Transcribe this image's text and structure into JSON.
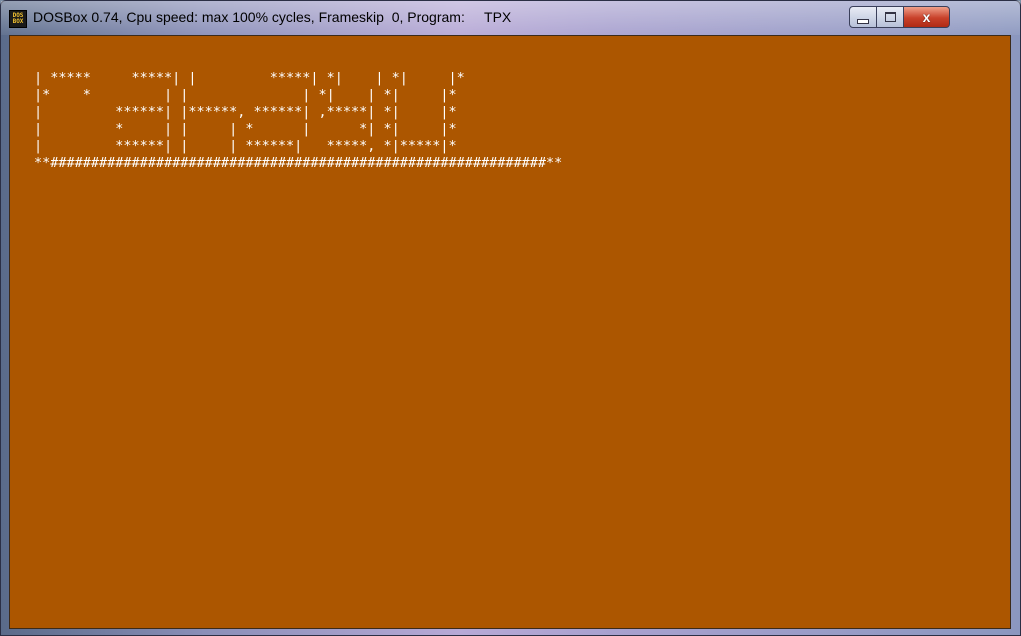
{
  "window": {
    "title": "DOSBox 0.74, Cpu speed: max 100% cycles, Frameskip  0, Program:     TPX",
    "icon": "dosbox-icon",
    "icon_text_top": "DOS",
    "icon_text_bottom": "BOX",
    "controls": {
      "minimize_icon": "minimize-icon",
      "maximize_icon": "maximize-icon",
      "close_glyph": "x"
    }
  },
  "screen": {
    "background_color": "#ac5600",
    "text_color": "#ffffff",
    "lines": [
      "| *****     *****| |         *****| *|    | *|     |*",
      "|*    *         | |              | *|    | *|     |*",
      "|         ******| |******, ******| ,*****| *|     |*",
      "|         *     | |     | *      |      *| *|     |*",
      "|         ******| |     | ******|   *****, *|*****|*",
      "**#############################################################**"
    ]
  }
}
